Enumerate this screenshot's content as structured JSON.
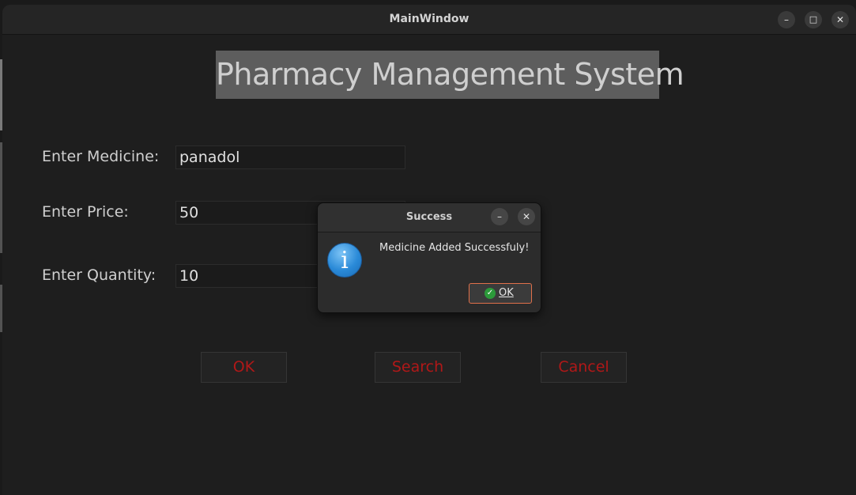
{
  "window": {
    "title": "MainWindow",
    "minimize": "–",
    "maximize": "□",
    "close": "✕"
  },
  "heading": "Pharmacy Management System",
  "form": {
    "medicine_label": "Enter Medicine:",
    "medicine_value": "panadol",
    "price_label": "Enter Price:",
    "price_value": "50",
    "quantity_label": "Enter Quantity:",
    "quantity_value": "10"
  },
  "buttons": {
    "ok": "OK",
    "search": "Search",
    "cancel": "Cancel"
  },
  "dialog": {
    "title": "Success",
    "minimize": "–",
    "close": "✕",
    "icon_glyph": "i",
    "message": "Medicine Added Successfuly!",
    "ok_label": "OK",
    "ok_check": "✓"
  },
  "colors": {
    "button_text": "#b01818",
    "heading_bg": "#5d5d5d",
    "dialog_ok_border": "#e0704a",
    "info_icon": "#2a8ad8"
  },
  "icons": [
    "window-minimize-icon",
    "window-maximize-icon",
    "window-close-icon",
    "info-icon",
    "check-icon"
  ]
}
